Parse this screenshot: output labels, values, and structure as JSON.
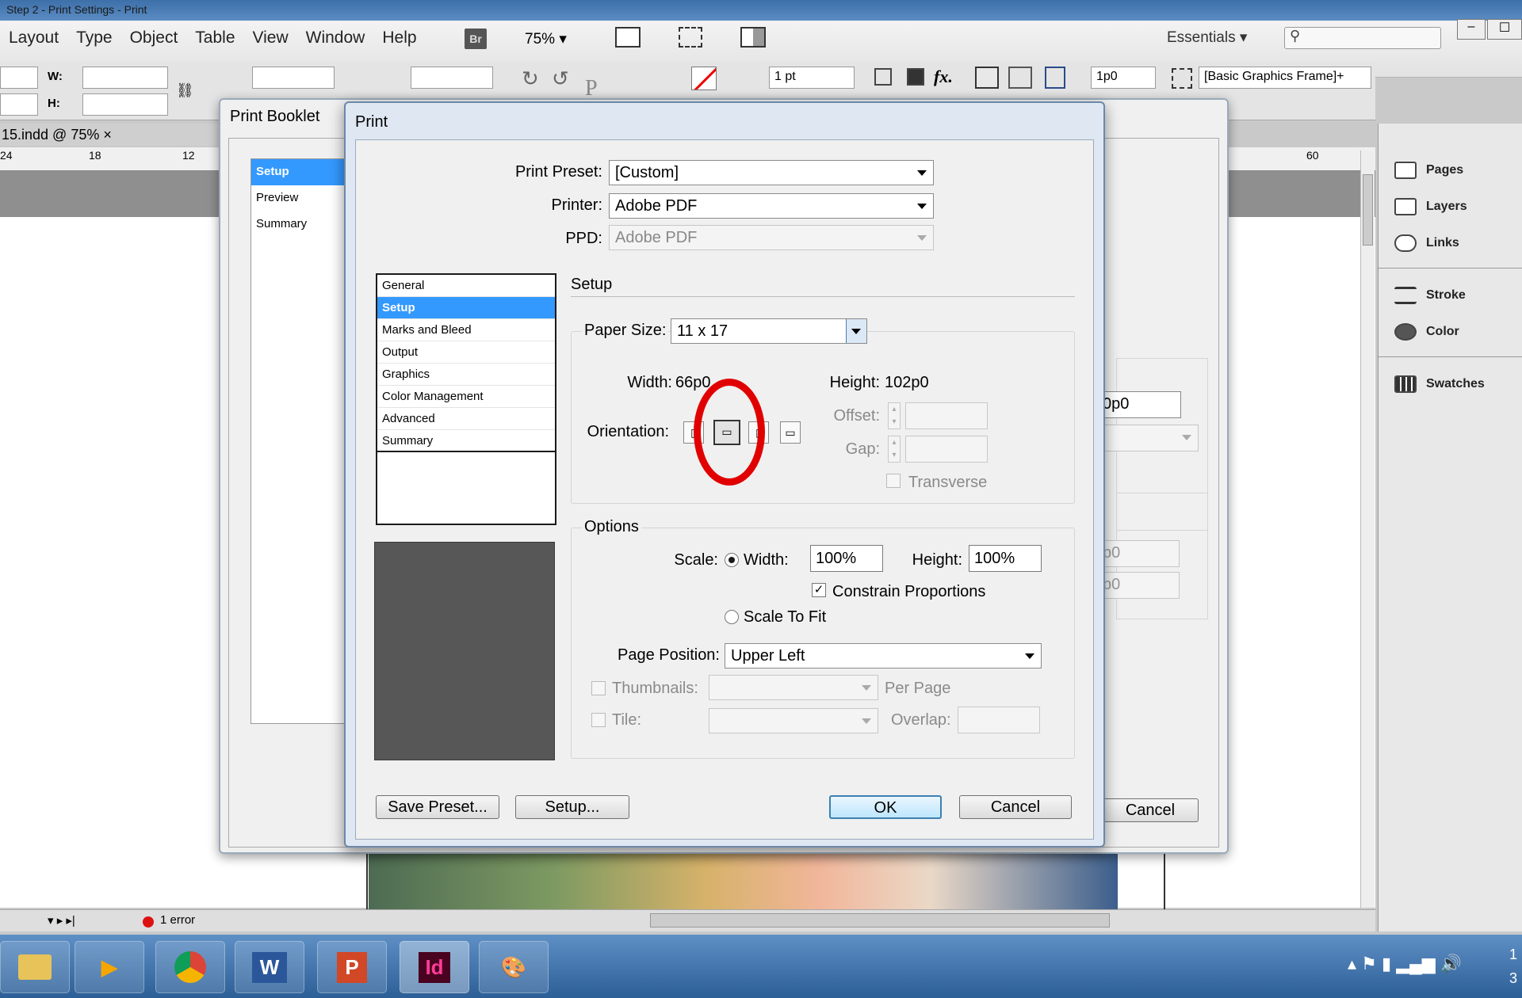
{
  "window": {
    "title": "Step 2 - Print Settings - Print"
  },
  "menu": {
    "items": [
      "Layout",
      "Type",
      "Object",
      "Table",
      "View",
      "Window",
      "Help"
    ],
    "bridge": "Br",
    "zoom": "75%",
    "workspace": "Essentials"
  },
  "control": {
    "w_label": "W:",
    "h_label": "H:",
    "stroke_weight": "1 pt",
    "fx": "fx.",
    "frame_offset": "1p0",
    "object_style": "[Basic Graphics Frame]+"
  },
  "document": {
    "tab": "15.indd @ 75%",
    "ruler": [
      "24",
      "18",
      "12",
      "60"
    ]
  },
  "status": {
    "errors": "1 error"
  },
  "panels": [
    {
      "label": "Pages",
      "icon": "pages-icon"
    },
    {
      "label": "Layers",
      "icon": "layers-icon"
    },
    {
      "label": "Links",
      "icon": "links-icon"
    },
    {
      "label": "Stroke",
      "icon": "stroke-icon"
    },
    {
      "label": "Color",
      "icon": "color-icon"
    },
    {
      "label": "Swatches",
      "icon": "swatches-icon"
    }
  ],
  "booklet": {
    "title": "Print Booklet",
    "nav": [
      "Setup",
      "Preview",
      "Summary"
    ],
    "behind_field_1": "0p0",
    "behind_field_2": "p0",
    "behind_field_3": "p0",
    "cancel": "Cancel"
  },
  "print": {
    "title": "Print",
    "preset_label": "Print Preset:",
    "preset_value": "[Custom]",
    "printer_label": "Printer:",
    "printer_value": "Adobe PDF",
    "ppd_label": "PPD:",
    "ppd_value": "Adobe PDF",
    "categories": [
      "General",
      "Setup",
      "Marks and Bleed",
      "Output",
      "Graphics",
      "Color Management",
      "Advanced",
      "Summary"
    ],
    "section_title": "Setup",
    "paper_size_label": "Paper Size:",
    "paper_size_value": "11 x 17",
    "width_label": "Width:",
    "width_value": "66p0",
    "height_label": "Height:",
    "height_value": "102p0",
    "orientation_label": "Orientation:",
    "offset_label": "Offset:",
    "gap_label": "Gap:",
    "transverse_label": "Transverse",
    "options_title": "Options",
    "scale_label": "Scale:",
    "scale_width_label": "Width:",
    "scale_width_value": "100%",
    "scale_height_label": "Height:",
    "scale_height_value": "100%",
    "constrain_label": "Constrain Proportions",
    "scale_to_fit_label": "Scale To Fit",
    "page_position_label": "Page Position:",
    "page_position_value": "Upper Left",
    "thumbnails_label": "Thumbnails:",
    "per_page_label": "Per Page",
    "tile_label": "Tile:",
    "overlap_label": "Overlap:",
    "save_preset": "Save Preset...",
    "setup_btn": "Setup...",
    "ok": "OK",
    "cancel": "Cancel"
  },
  "taskbar": {
    "apps": [
      "W",
      "P",
      "Id"
    ],
    "clock": "1 3"
  },
  "colors": {
    "selection": "#3399ff",
    "highlight_circle": "#e10000",
    "taskbar": "#2d5f97"
  }
}
